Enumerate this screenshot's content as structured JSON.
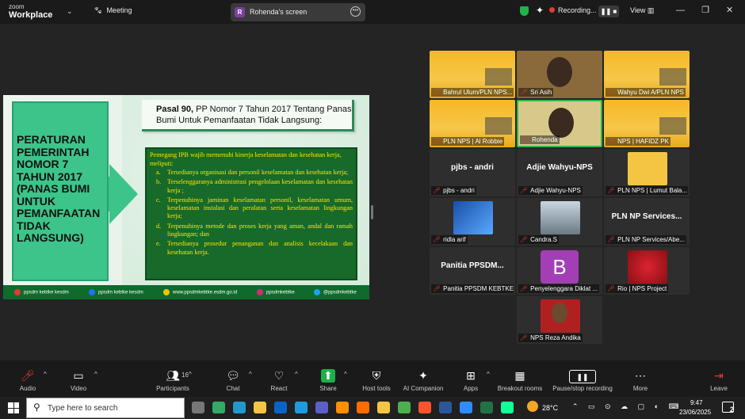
{
  "topbar": {
    "logo_small": "zoom",
    "logo_big": "Workplace",
    "meeting_label": "Meeting",
    "share_initial": "R",
    "share_label": "Rohenda's screen",
    "recording_label": "Recording...",
    "view_label": "View"
  },
  "slide": {
    "left_title": "PERATURAN PEMERINTAH NOMOR 7 TAHUN 2017 (PANAS BUMI UNTUK PEMANFAATAN TIDAK LANGSUNG)",
    "title_bold": "Pasal 90,",
    "title_rest": " PP Nomor 7 Tahun 2017 Tentang Panas Bumi Untuk Pemanfaatan Tidak Langsung:",
    "intro": "Pemegang IPB wajib memenuhi kinerja keselamatan  dan kesehatan kerja, meliputi:",
    "items": [
      {
        "k": "a.",
        "v": "Tersedianya organisasi dan personil keselamatan dan kesehatan kerja;"
      },
      {
        "k": "b.",
        "v": "Terselenggaranya administrasi pengelolaan keselamatan dan kesehatan kerja ;"
      },
      {
        "k": "c.",
        "v": "Terpenuhinya jaminan keselamatan personil, keselamatan umum, keselamatan instalasi dan peralatan serta keselamatan lingkungan kerja;"
      },
      {
        "k": "d.",
        "v": "Terpenuhinya metode dan proses kerja yang aman, andal dan ramah lingkungan; dan"
      },
      {
        "k": "e.",
        "v": "Tersedianya prosedur penanganan dan analisis kecelakaan dan kesehatan kerja."
      }
    ],
    "footer": [
      {
        "text": "ppsdm kebtke kesdm",
        "color": "#e53935"
      },
      {
        "text": "ppsdm kebtke kesdm",
        "color": "#1877f2"
      },
      {
        "text": "www.ppsdmkebtke.esdm.go.id",
        "color": "#f4c20d"
      },
      {
        "text": "ppsdmkebtke",
        "color": "#d62976"
      },
      {
        "text": "@ppsdmkebtke",
        "color": "#1da1f2"
      }
    ]
  },
  "gallery": {
    "tiles": [
      {
        "name": "Bahrul Ulum/PLN NPS...",
        "type": "poster"
      },
      {
        "name": "Sri Asih",
        "type": "person"
      },
      {
        "name": "Wahyu Dwi A/PLN NPS",
        "type": "poster"
      },
      {
        "name": "PLN NPS | Al Robbie",
        "type": "poster"
      },
      {
        "name": "Rohenda",
        "type": "person-hl"
      },
      {
        "name": "NPS | HAFIDZ PK",
        "type": "poster"
      },
      {
        "name": "pjbs - andri",
        "big": "pjbs - andri",
        "type": "text"
      },
      {
        "name": "Adjie Wahyu-NPS",
        "big": "Adjie Wahyu-NPS",
        "type": "text"
      },
      {
        "name": "PLN NPS | Lumut Bala...",
        "type": "thumb-poster"
      },
      {
        "name": "ridla arif",
        "type": "thumb-blue"
      },
      {
        "name": "Candra.S",
        "type": "thumb-building"
      },
      {
        "name": "PLN NP Services/Abe...",
        "big": "PLN NP Services...",
        "type": "text"
      },
      {
        "name": "Panitia PPSDM KEBTKE",
        "big": "Panitia  PPSDM...",
        "type": "text"
      },
      {
        "name": "Penyelenggara Diklat ...",
        "initial": "B",
        "type": "initial"
      },
      {
        "name": "Rio | NPS Project",
        "type": "thumb-red"
      },
      {
        "name": "NPS Reza Andika",
        "type": "thumb-man"
      }
    ]
  },
  "toolbar": {
    "audio": "Audio",
    "video": "Video",
    "participants": "Participants",
    "participants_count": "16",
    "chat": "Chat",
    "react": "React",
    "share": "Share",
    "host_tools": "Host tools",
    "ai_companion": "AI Companion",
    "apps": "Apps",
    "breakout": "Breakout rooms",
    "pause_rec": "Pause/stop recording",
    "more": "More",
    "leave": "Leave"
  },
  "taskbar": {
    "search_placeholder": "Type here to search",
    "temp": "28°C",
    "time": "9:47",
    "date": "23/06/2025",
    "notif_count": "2"
  }
}
